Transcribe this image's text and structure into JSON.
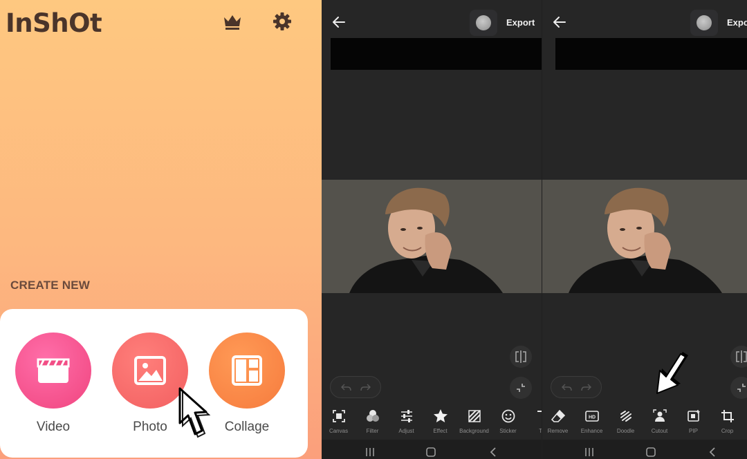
{
  "home": {
    "logo": "InShOt",
    "crown_icon": "crown-icon",
    "settings_icon": "gear-icon",
    "create_new_label": "CREATE NEW",
    "items": [
      {
        "label": "Video",
        "icon": "clapperboard-icon",
        "color": "#f24e86"
      },
      {
        "label": "Photo",
        "icon": "image-icon",
        "color": "#f46563"
      },
      {
        "label": "Collage",
        "icon": "layout-icon",
        "color": "#f8853f"
      }
    ]
  },
  "editors": [
    {
      "export_label": "Export",
      "tools": [
        {
          "label": "Canvas",
          "icon": "canvas-icon"
        },
        {
          "label": "Filter",
          "icon": "filter-icon"
        },
        {
          "label": "Adjust",
          "icon": "sliders-icon"
        },
        {
          "label": "Effect",
          "icon": "star-icon"
        },
        {
          "label": "Background",
          "icon": "hatch-icon"
        },
        {
          "label": "Sticker",
          "icon": "smiley-icon"
        },
        {
          "label": "Te",
          "icon": "text-icon"
        }
      ]
    },
    {
      "export_label": "Export",
      "tools": [
        {
          "label": "Remove",
          "icon": "eraser-icon"
        },
        {
          "label": "Enhance",
          "icon": "hd-icon"
        },
        {
          "label": "Doodle",
          "icon": "doodle-icon"
        },
        {
          "label": "Cutout",
          "icon": "person-cutout-icon"
        },
        {
          "label": "PIP",
          "icon": "pip-icon"
        },
        {
          "label": "Crop",
          "icon": "crop-icon"
        }
      ]
    }
  ],
  "colors": {
    "home_gradient_top": "#fec880",
    "home_gradient_bottom": "#fb9f7c",
    "editor_bg": "#262626",
    "tool_label": "#8f8f8f"
  }
}
